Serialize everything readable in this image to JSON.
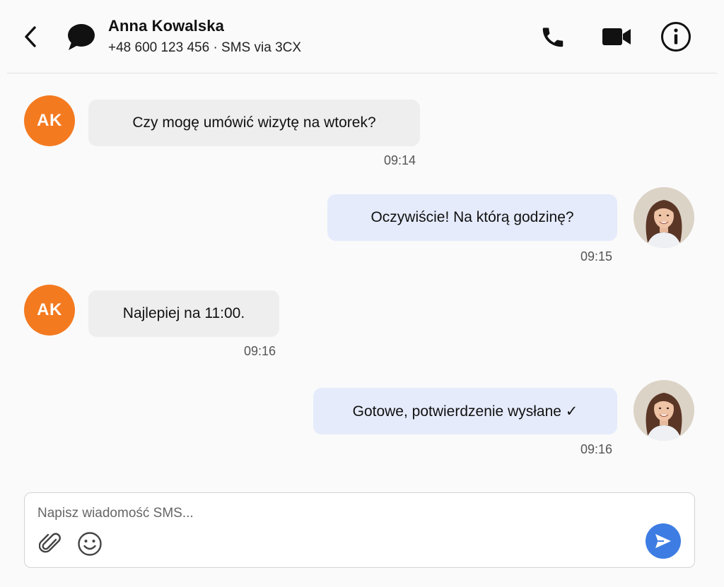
{
  "header": {
    "contact_name": "Anna Kowalska",
    "contact_subtitle": "+48 600 123 456 · SMS via 3CX",
    "icons": [
      "back-arrow-icon",
      "chat-bubble-icon",
      "phone-icon",
      "video-camera-icon",
      "info-icon"
    ]
  },
  "contact": {
    "initials": "AK",
    "avatar_color": "#f47a20"
  },
  "messages": [
    {
      "direction": "incoming",
      "text": "Czy mogę umówić wizytę na wtorek?",
      "time": "09:14"
    },
    {
      "direction": "outgoing",
      "text": "Oczywiście! Na którą godzinę?",
      "time": "09:15"
    },
    {
      "direction": "incoming",
      "text": "Najlepiej na 11:00.",
      "time": "09:16"
    },
    {
      "direction": "outgoing",
      "text": "Gotowe, potwierdzenie wysłane ✓",
      "time": "09:16"
    }
  ],
  "composer": {
    "placeholder": "Napisz wiadomość SMS...",
    "value": "",
    "icons": [
      "paperclip-icon",
      "emoji-icon",
      "send-icon"
    ]
  },
  "colors": {
    "incoming_bubble": "#eeeeee",
    "outgoing_bubble": "#e5ebfb",
    "send_button": "#3d7de3"
  }
}
